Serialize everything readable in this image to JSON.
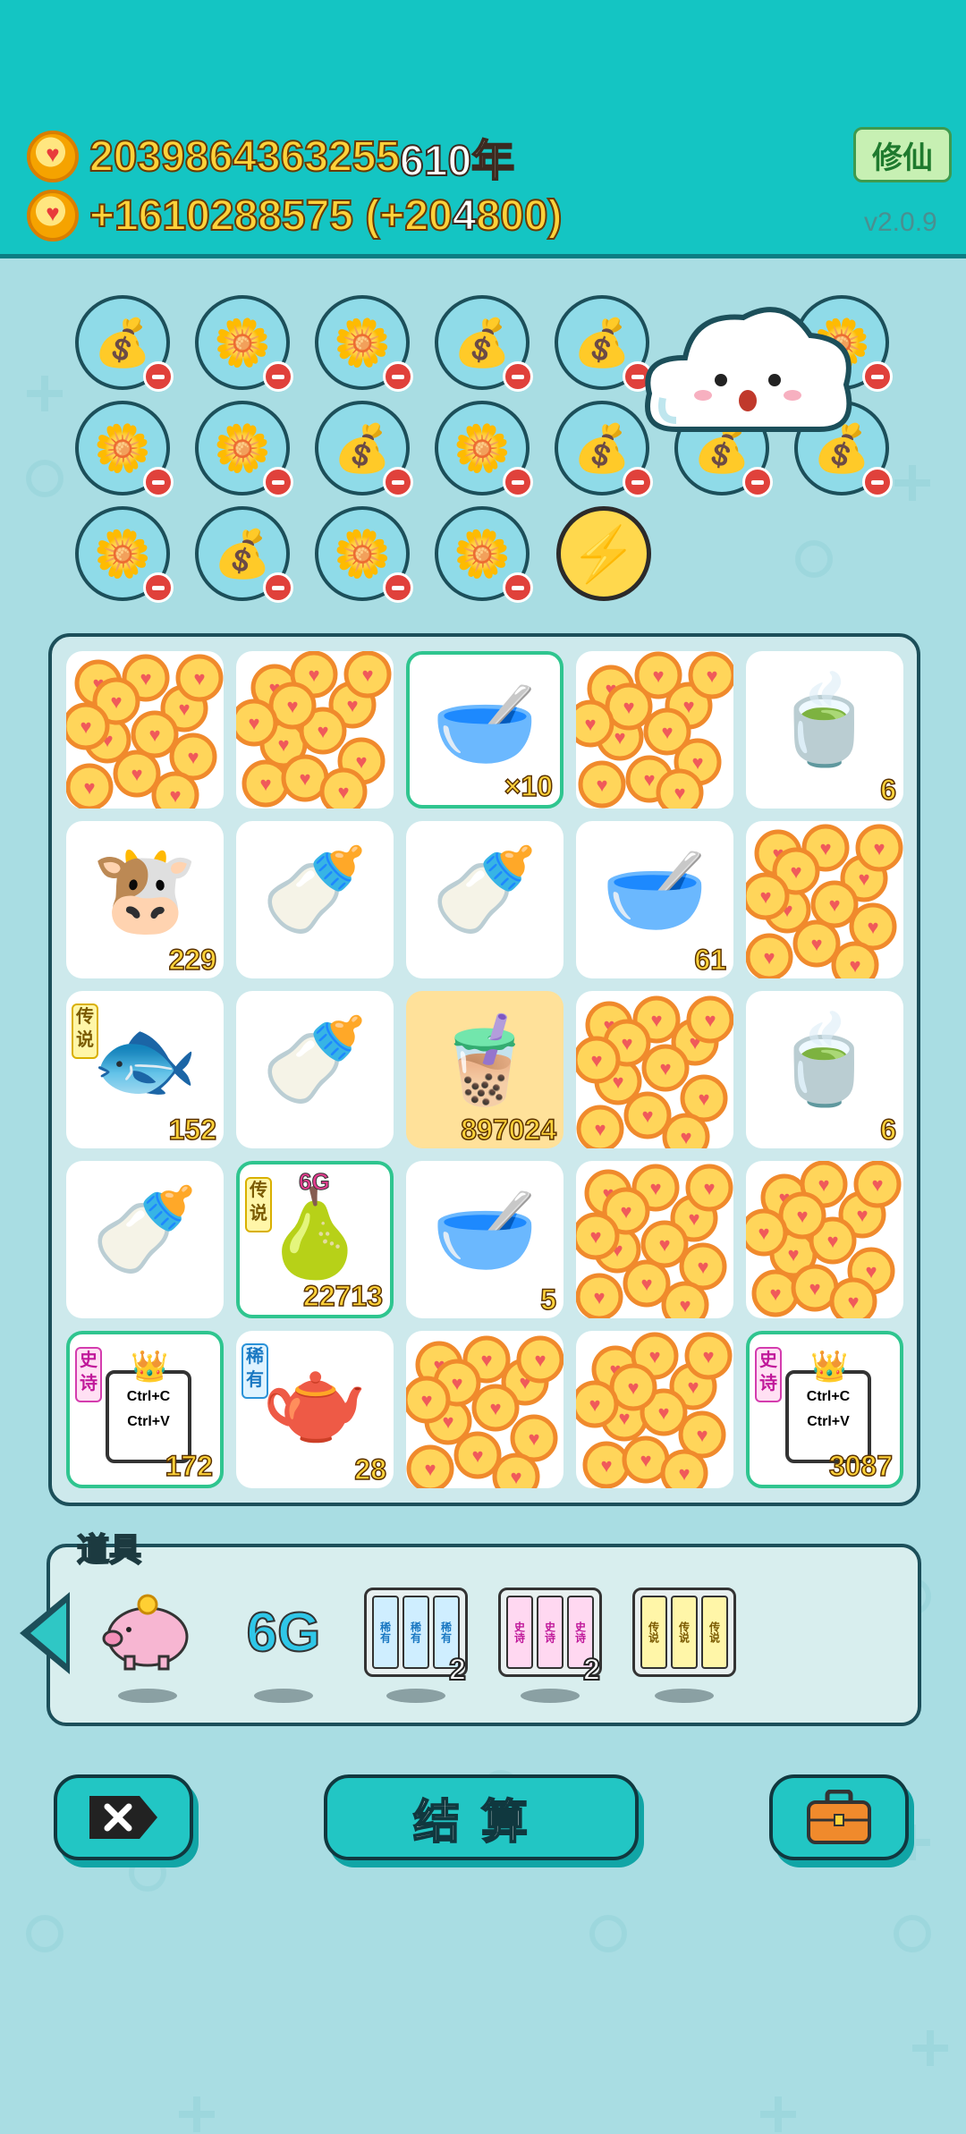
{
  "header": {
    "total_gold": "2039864363255",
    "total_suffix": "610年",
    "rate_prefix": "+1610288575 (+20",
    "rate_mid": "4",
    "rate_suffix": "800)",
    "xiuxian_button": "修仙",
    "version": "v2.0.9"
  },
  "plants": [
    {
      "kind": "bag-icon"
    },
    {
      "kind": "flower-pot-icon"
    },
    {
      "kind": "flower-pot-icon"
    },
    {
      "kind": "bag-icon"
    },
    {
      "kind": "bag-icon"
    },
    {
      "kind": "cloud-mascot"
    },
    {
      "kind": "flower-pot-icon"
    },
    {
      "kind": "flower-pot-icon"
    },
    {
      "kind": "flower-pot-icon"
    },
    {
      "kind": "bag-icon"
    },
    {
      "kind": "flower-pot-icon"
    },
    {
      "kind": "bag-icon"
    },
    {
      "kind": "bag-icon"
    },
    {
      "kind": "bag-icon"
    },
    {
      "kind": "flower-pot-icon"
    },
    {
      "kind": "bag-icon"
    },
    {
      "kind": "flower-pot-icon"
    },
    {
      "kind": "flower-pot-icon"
    },
    {
      "kind": "lightning-icon"
    }
  ],
  "board": {
    "cells": [
      {
        "item": "coins",
        "count": ""
      },
      {
        "item": "coins",
        "count": ""
      },
      {
        "item": "bowl-icon",
        "count": "×10",
        "highlight": true
      },
      {
        "item": "coins",
        "count": ""
      },
      {
        "item": "tea-bowl-icon",
        "count": "6"
      },
      {
        "item": "cow-icon",
        "count": "229"
      },
      {
        "item": "milk-bottle-icon",
        "count": ""
      },
      {
        "item": "milk-bottle-icon",
        "count": ""
      },
      {
        "item": "bowl-icon",
        "count": "61"
      },
      {
        "item": "coins",
        "count": ""
      },
      {
        "item": "koi-fish-icon",
        "count": "152",
        "tag": "传说",
        "tagType": "legend"
      },
      {
        "item": "milk-bottle-icon",
        "count": ""
      },
      {
        "item": "bubble-tea-cup-icon",
        "count": "897024",
        "gold": true
      },
      {
        "item": "coins",
        "count": ""
      },
      {
        "item": "tea-bowl-icon",
        "count": "6"
      },
      {
        "item": "milk-bottle-icon",
        "count": ""
      },
      {
        "item": "pear-icon",
        "count": "22713",
        "tag": "传说",
        "tagType": "legend",
        "badge": "6G",
        "highlight": true
      },
      {
        "item": "bowl-icon",
        "count": "5"
      },
      {
        "item": "coins",
        "count": ""
      },
      {
        "item": "coins",
        "count": ""
      },
      {
        "item": "copy-paste-card-icon",
        "count": "172",
        "tag": "史诗",
        "tagType": "epic",
        "highlight": true
      },
      {
        "item": "teapot-icon",
        "count": "28",
        "tag": "稀有",
        "tagType": "rare"
      },
      {
        "item": "coins",
        "count": ""
      },
      {
        "item": "coins",
        "count": ""
      },
      {
        "item": "copy-paste-card-icon",
        "count": "3087",
        "tag": "史诗",
        "tagType": "epic",
        "highlight": true
      }
    ],
    "ctrl_c": "Ctrl+C",
    "ctrl_v": "Ctrl+V"
  },
  "tools": {
    "label": "道具",
    "items": [
      {
        "name": "piggy-bank-icon",
        "count": ""
      },
      {
        "name": "6g-icon",
        "text": "6G",
        "count": ""
      },
      {
        "name": "rare-card-pack-icon",
        "card": "稀有",
        "count": "2"
      },
      {
        "name": "epic-card-pack-icon",
        "card": "史诗",
        "count": "2"
      },
      {
        "name": "legend-card-pack-icon",
        "card": "传说",
        "count": ""
      }
    ]
  },
  "buttons": {
    "settle": "结算"
  },
  "colors": {
    "header": "#14c5c3",
    "background": "#a9dde3",
    "button": "#22c6c4",
    "gold_text": "#ffd23a"
  }
}
